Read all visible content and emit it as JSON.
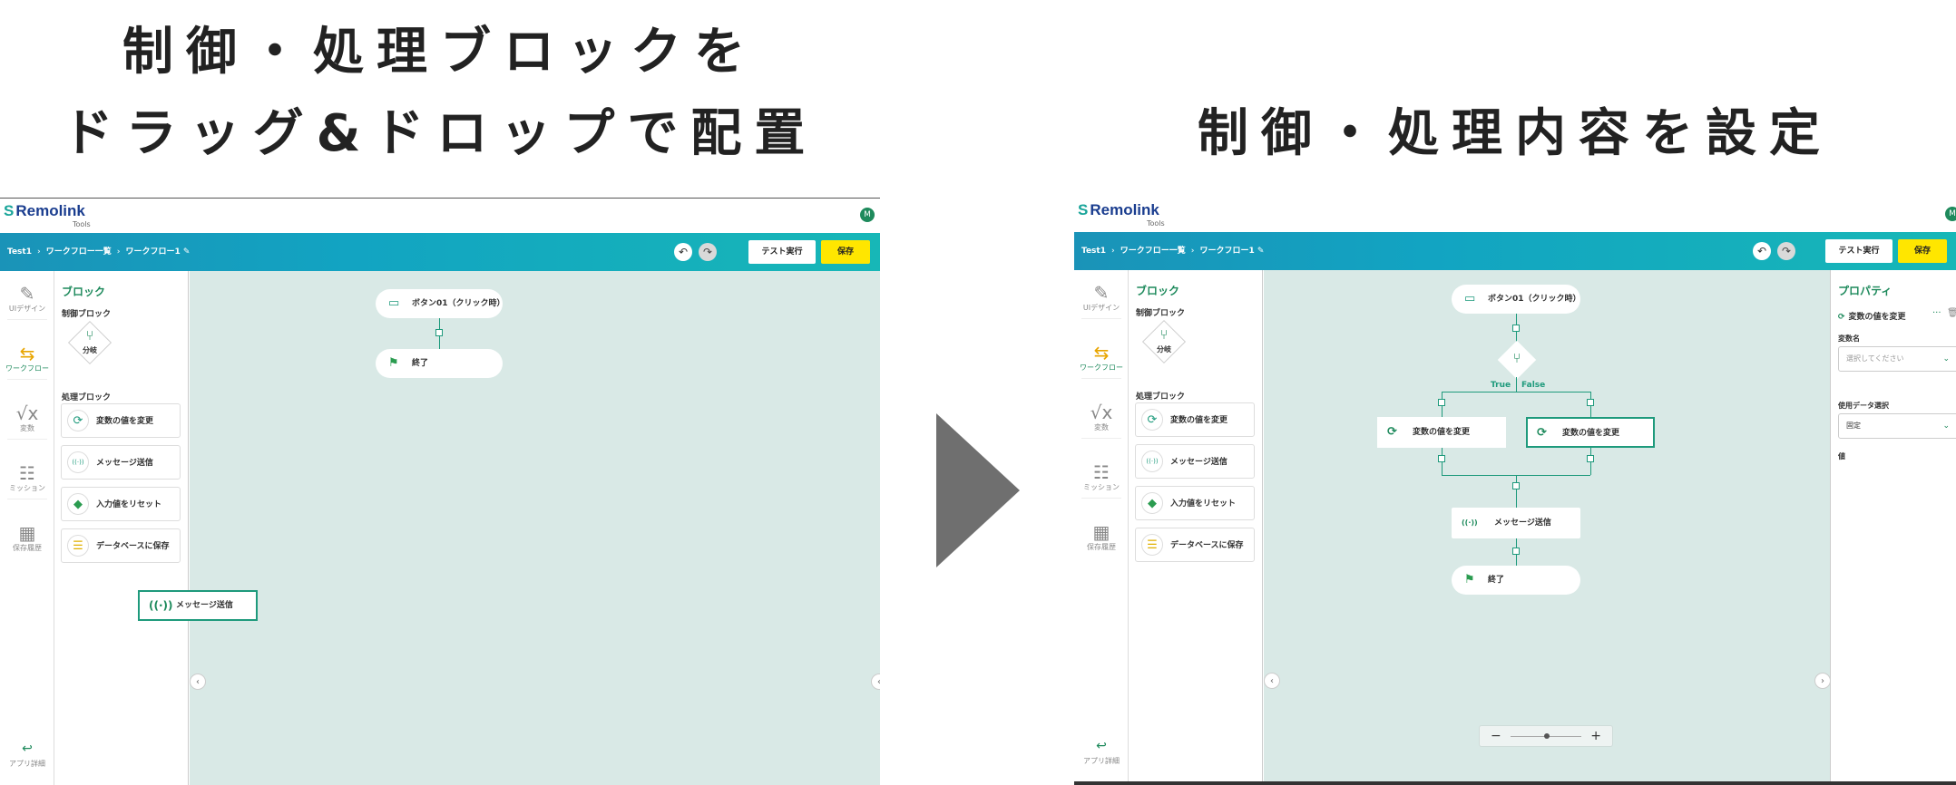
{
  "captions": {
    "left_line1": "制御・処理ブロックを",
    "left_line2": "ドラッグ&ドロップで配置",
    "right": "制御・処理内容を設定"
  },
  "app": {
    "logo": "Remolink",
    "logo_mark": "S",
    "logo_sub": "Tools",
    "avatar": "M"
  },
  "header": {
    "breadcrumb": [
      "Test1",
      "ワークフロー一覧",
      "ワークフロー1"
    ],
    "separator": "›",
    "edit_icon": "pencil-icon",
    "undo_icon": "↶",
    "redo_icon": "↷",
    "test_run": "テスト実行",
    "save": "保存"
  },
  "rail": {
    "items": [
      {
        "icon": "tools-icon",
        "glyph": "✎",
        "label": "UIデザイン"
      },
      {
        "icon": "workflow-icon",
        "glyph": "⇆",
        "label": "ワークフロー",
        "active": true
      },
      {
        "icon": "variable-icon",
        "glyph": "√x",
        "label": "変数"
      },
      {
        "icon": "clipboard-icon",
        "glyph": "☷",
        "label": "ミッション"
      },
      {
        "icon": "calendar-icon",
        "glyph": "▦",
        "label": "保存履歴"
      }
    ],
    "back_label": "アプリ詳細",
    "back_glyph": "↩"
  },
  "blocks": {
    "title": "ブロック",
    "control_section": "制御ブロック",
    "branch_label": "分岐",
    "process_section": "処理ブロック",
    "items": [
      {
        "icon": "refresh-icon",
        "glyph": "⟳",
        "color": "#1e9a7c",
        "label": "変数の値を変更"
      },
      {
        "icon": "broadcast-icon",
        "glyph": "((·))",
        "color": "#1e9a7c",
        "label": "メッセージ送信"
      },
      {
        "icon": "eraser-icon",
        "glyph": "◆",
        "color": "#2b9c50",
        "label": "入力値をリセット"
      },
      {
        "icon": "database-icon",
        "glyph": "☰",
        "color": "#e0b000",
        "label": "データベースに保存"
      }
    ]
  },
  "left_canvas": {
    "start_node": "ボタン01（クリック時）",
    "end_node": "終了",
    "dragging": "メッセージ送信"
  },
  "right_canvas": {
    "start_node": "ボタン01（クリック時）",
    "true_label": "True",
    "false_label": "False",
    "branch_left": "変数の値を変更",
    "branch_right": "変数の値を変更",
    "message_node": "メッセージ送信",
    "end_node": "終了",
    "zoom_minus": "−",
    "zoom_plus": "+",
    "zoom_level": 0.5
  },
  "properties": {
    "title": "プロパティ",
    "block_name": "変数の値を変更",
    "variable_label": "変数名",
    "variable_placeholder": "選択してください",
    "data_label": "使用データ選択",
    "data_value": "固定",
    "value_label": "値"
  },
  "colors": {
    "accent": "#1e8a5c",
    "save_button": "#ffe600",
    "canvas_bg": "#d9e9e6",
    "header_gradient_start": "#1a93b8",
    "header_gradient_end": "#17b7b7",
    "arrow": "#6f6f6f"
  }
}
